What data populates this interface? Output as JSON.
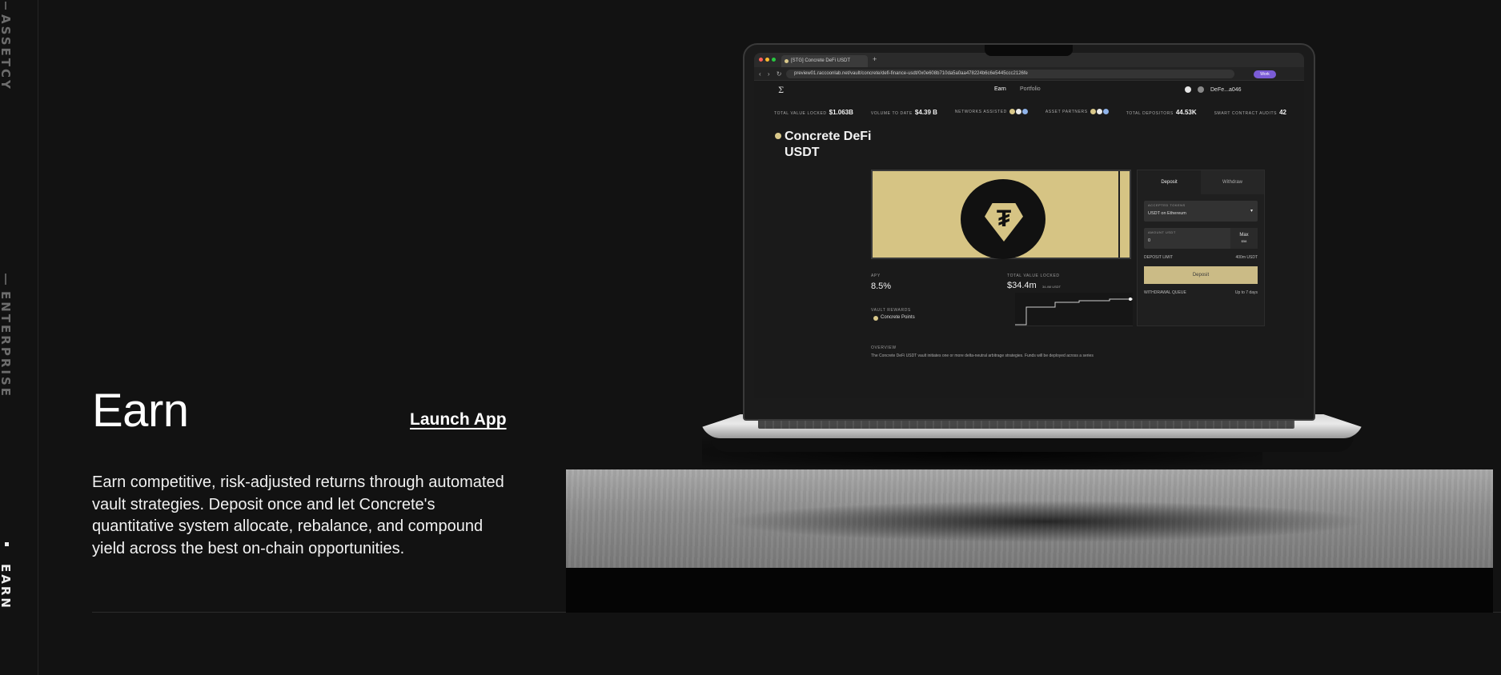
{
  "rail": {
    "items": [
      {
        "label": "ASSETCY",
        "active": false
      },
      {
        "label": "ENTERPRISE",
        "active": false
      },
      {
        "label": "EARN",
        "active": true
      }
    ]
  },
  "hero": {
    "title": "Earn",
    "cta": "Launch App",
    "description": "Earn competitive, risk-adjusted returns through automated vault strategies. Deposit once and let Concrete's quantitative system allocate, rebalance, and compound yield across the best on-chain opportunities."
  },
  "mockup": {
    "tab_title": "[STG] Concrete DeFi USDT",
    "url": "preview01.raccoonlab.net/vault/concrete/defi-finance-usdt/0x0e608b710da5a0aa478224b6c6e5445ccc2126fe",
    "profile_pill": "Work",
    "nav": {
      "earn": "Earn",
      "portfolio": "Portfolio",
      "account": "DeFe...a046"
    },
    "stats": [
      {
        "label": "TOTAL VALUE LOCKED",
        "value": "$1.063B"
      },
      {
        "label": "VOLUME TO DATE",
        "value": "$4.39 B"
      },
      {
        "label": "NETWORKS ASSISTED",
        "value": ""
      },
      {
        "label": "ASSET PARTNERS",
        "value": ""
      },
      {
        "label": "TOTAL DEPOSITORS",
        "value": "44.53K"
      },
      {
        "label": "SMART CONTRACT AUDITS",
        "value": "42"
      }
    ],
    "vault_title": "Concrete DeFi USDT",
    "metrics": {
      "apy_label": "APY",
      "apy_value": "8.5%",
      "tvl_label": "TOTAL VALUE LOCKED",
      "tvl_value": "$34.4m",
      "tvl_sub": "34.4M USDT",
      "rewards_label": "VAULT REWARDS",
      "rewards_value": "Concrete Points",
      "overview_label": "OVERVIEW",
      "overview_text": "The Concrete DeFi USDT vault initiates one or more delta-neutral arbitrage strategies. Funds will be deployed across a series"
    },
    "panel": {
      "tab_deposit": "Deposit",
      "tab_withdraw": "Withdraw",
      "accepted_label": "ACCEPTED TOKENS",
      "accepted_value": "USDT on Ethereum",
      "amount_label": "AMOUNT USDT",
      "amount_value": "0",
      "max_label": "Max",
      "max_value": "$58",
      "limit_label": "DEPOSIT LIMIT",
      "limit_value": "400m USDT",
      "deposit_button": "Deposit",
      "queue_label": "WITHDRAWAL QUEUE",
      "queue_value": "Up to 7 days"
    }
  },
  "colors": {
    "background": "#121212",
    "accent_gold": "#d6c484",
    "text": "#f2f2f2"
  }
}
